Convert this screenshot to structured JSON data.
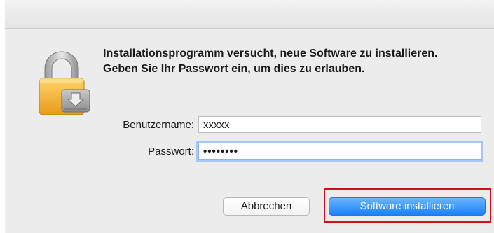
{
  "dialog": {
    "message": "Installationsprogramm versucht, neue Software zu installieren. Geben Sie Ihr Passwort ein, um dies zu erlauben.",
    "icon": "lock-install-icon"
  },
  "form": {
    "username_label": "Benutzername:",
    "username_value": "xxxxx",
    "password_label": "Passwort:",
    "password_value": "••••••••"
  },
  "buttons": {
    "cancel_label": "Abbrechen",
    "install_label": "Software installieren"
  },
  "colors": {
    "primary_button": "#1a82fb",
    "highlight": "#d0101b",
    "focus_ring": "#a6c8f5"
  }
}
